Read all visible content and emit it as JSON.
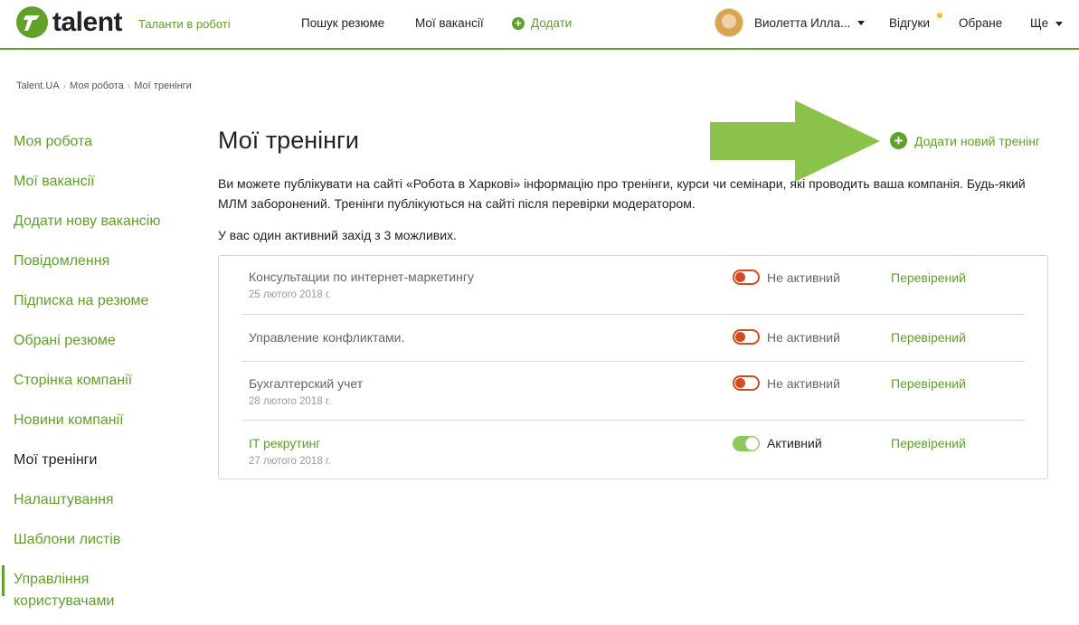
{
  "header": {
    "logo_text": "talent",
    "tagline": "Таланти в роботі",
    "nav": {
      "search": "Пошук резюме",
      "vacancies": "Мої вакансії",
      "add": "Додати"
    },
    "user_name": "Виолетта Илла...",
    "responses": "Відгуки",
    "favorites": "Обране",
    "more": "Ще"
  },
  "breadcrumb": [
    "Talent.UA",
    "Моя робота",
    "Мої тренінги"
  ],
  "sidebar": {
    "items": [
      "Моя робота",
      "Мої вакансії",
      "Додати нову вакансію",
      "Повідомлення",
      "Підписка на резюме",
      "Обрані резюме",
      "Сторінка компанії",
      "Новини компанії",
      "Мої тренінги",
      "Налаштування",
      "Шаблони листів",
      "Управління користувачами"
    ],
    "active_index": 8
  },
  "main": {
    "title": "Мої тренінги",
    "add_training": "Додати новий тренінг",
    "description": "Ви можете публікувати на сайті «Робота в Харкові» інформацію про тренінги, курси чи семінари, які проводить ваша компанія. Будь-який МЛМ заборонений. Тренінги публікуються на сайті після перевірки модератором.",
    "summary": "У вас один активний захід з 3 можливих.",
    "trainings": [
      {
        "name": "Консультации по интернет-маркетингу",
        "date": "25 лютого 2018 г.",
        "status": "Не активний",
        "active": false,
        "verification": "Перевірений"
      },
      {
        "name": "Управление конфликтами.",
        "date": "",
        "status": "Не активний",
        "active": false,
        "verification": "Перевірений"
      },
      {
        "name": "Бухгалтерский учет",
        "date": "28 лютого 2018 г.",
        "status": "Не активний",
        "active": false,
        "verification": "Перевірений"
      },
      {
        "name": "IT рекрутинг",
        "date": "27 лютого 2018 г.",
        "status": "Активний",
        "active": true,
        "verification": "Перевірений"
      }
    ]
  },
  "colors": {
    "brand": "#5fa12a",
    "toggle_off": "#d94a1a",
    "toggle_on": "#8cc85a",
    "notification_dot": "#f2c31b"
  }
}
